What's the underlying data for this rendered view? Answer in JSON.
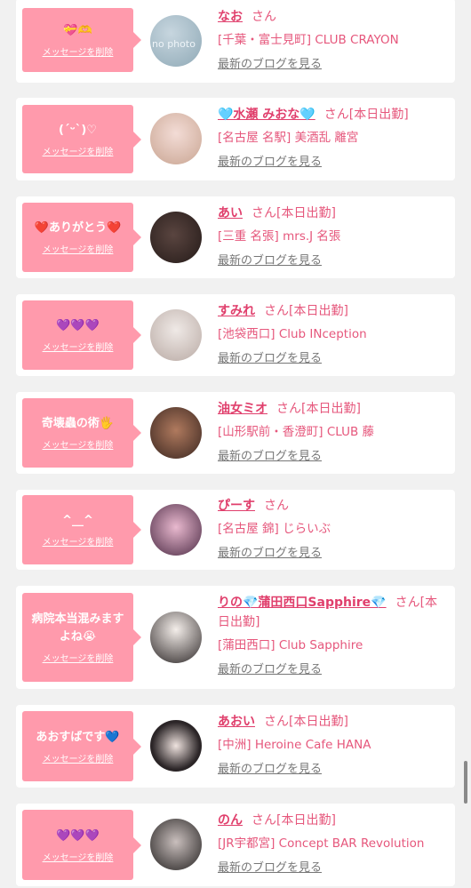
{
  "entries": [
    {
      "message": "💝🫶",
      "delete_label": "メッセージを削除",
      "name": "なお",
      "san": "さん",
      "status": "",
      "shop": "[千葉・富士見町] CLUB CRAYON",
      "blog_label": "最新のブログを見る",
      "avatar_text": "no photo"
    },
    {
      "message": "(´ᵕ`)♡",
      "delete_label": "メッセージを削除",
      "name": "🩵水瀬 みおな🩵",
      "san": "さん",
      "status": "[本日出勤]",
      "shop": "[名古屋 名駅] 美酒乱 離宮",
      "blog_label": "最新のブログを見る"
    },
    {
      "message": "❤️ありがとう❤️",
      "delete_label": "メッセージを削除",
      "name": "あい",
      "san": "さん",
      "status": "[本日出勤]",
      "shop": "[三重 名張] mrs.J 名張",
      "blog_label": "最新のブログを見る"
    },
    {
      "message": "💜💜💜",
      "delete_label": "メッセージを削除",
      "name": "すみれ",
      "san": "さん",
      "status": "[本日出勤]",
      "shop": "[池袋西口] Club INception",
      "blog_label": "最新のブログを見る"
    },
    {
      "message": "奇壊蟲の術🖐️",
      "delete_label": "メッセージを削除",
      "name": "油女ミオ",
      "san": "さん",
      "status": "[本日出勤]",
      "shop": "[山形駅前・香澄町] CLUB 藤",
      "blog_label": "最新のブログを見る"
    },
    {
      "message": "^__^",
      "delete_label": "メッセージを削除",
      "name": "ぴーす",
      "san": "さん",
      "status": "",
      "shop": "[名古屋 錦] じらいぶ",
      "blog_label": "最新のブログを見る"
    },
    {
      "message": "病院本当混みます\nよね😭",
      "delete_label": "メッセージを削除",
      "name": "りの💎蒲田西口Sapphire💎",
      "san": "さん",
      "status": "[本日出勤]",
      "shop": "[蒲田西口] Club Sapphire",
      "blog_label": "最新のブログを見る"
    },
    {
      "message": "あおすばです💙",
      "delete_label": "メッセージを削除",
      "name": "あおい",
      "san": "さん",
      "status": "[本日出勤]",
      "shop": "[中洲] Heroine Cafe HANA",
      "blog_label": "最新のブログを見る"
    },
    {
      "message": "💜💜💜",
      "delete_label": "メッセージを削除",
      "name": "のん",
      "san": "さん",
      "status": "[本日出勤]",
      "shop": "[JR宇都宮] Concept BAR Revolution",
      "blog_label": "最新のブログを見る"
    }
  ],
  "colors": {
    "bubble": "#ff9aac",
    "name": "#e03f6c",
    "text": "#e6577c",
    "link": "#777777",
    "background": "#f1f1f1"
  }
}
